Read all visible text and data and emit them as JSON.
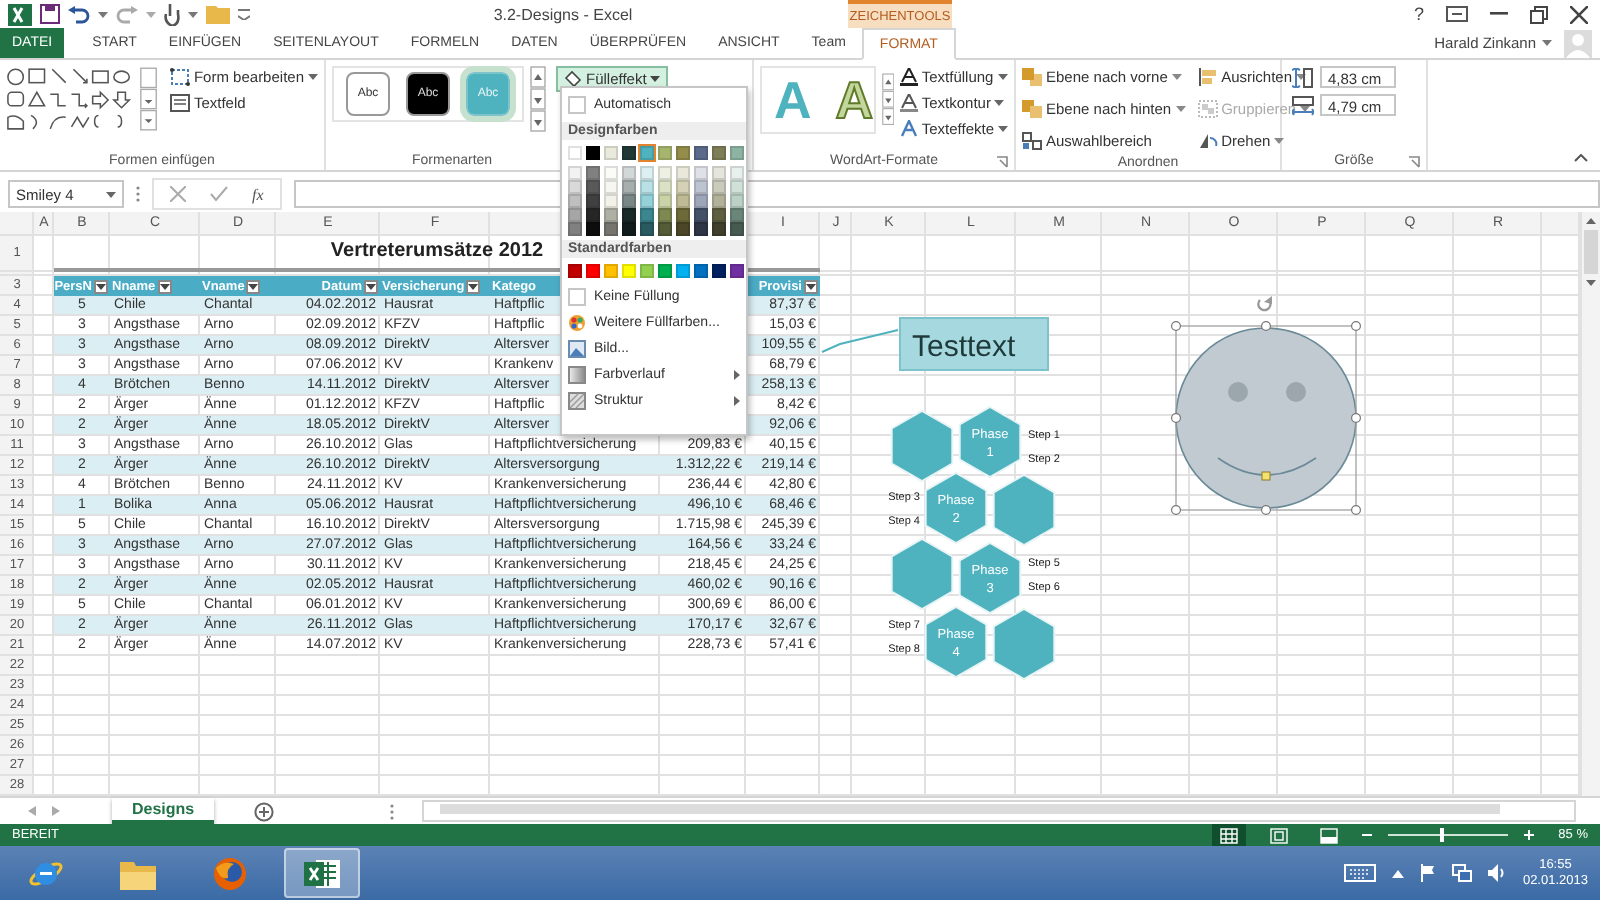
{
  "window": {
    "title": "3.2-Designs - Excel",
    "context_label": "ZEICHENTOOLS",
    "help": "?"
  },
  "tabs": [
    {
      "label": "DATEI",
      "kind": "file",
      "selected": false
    },
    {
      "label": "START",
      "kind": "tab",
      "selected": false
    },
    {
      "label": "EINFÜGEN",
      "kind": "tab",
      "selected": false
    },
    {
      "label": "SEITENLAYOUT",
      "kind": "tab",
      "selected": false
    },
    {
      "label": "FORMELN",
      "kind": "tab",
      "selected": false
    },
    {
      "label": "DATEN",
      "kind": "tab",
      "selected": false
    },
    {
      "label": "ÜBERPRÜFEN",
      "kind": "tab",
      "selected": false
    },
    {
      "label": "ANSICHT",
      "kind": "tab",
      "selected": false
    },
    {
      "label": "Team",
      "kind": "tab",
      "selected": false
    },
    {
      "label": "FORMAT",
      "kind": "context",
      "selected": true
    }
  ],
  "user": {
    "name": "Harald Zinkann"
  },
  "shapes_group": {
    "title": "Formen einfügen",
    "buttons": [
      {
        "label": "Form bearbeiten",
        "dropdown": true
      },
      {
        "label": "Textfeld",
        "dropdown": false
      }
    ]
  },
  "styles_group": {
    "title": "Formenarten",
    "styles": [
      {
        "label": "Abc",
        "kind": "outline",
        "selected": false
      },
      {
        "label": "Abc",
        "kind": "dark",
        "selected": false
      },
      {
        "label": "Abc",
        "kind": "teal",
        "selected": true
      }
    ],
    "fill_button": {
      "label": "Fülleffekt",
      "expanded": true
    }
  },
  "fill_menu": {
    "automatic": "Automatisch",
    "theme_header": "Designfarben",
    "standard_header": "Standardfarben",
    "theme_colors": [
      {
        "color": "#ffffff",
        "selected": false
      },
      {
        "color": "#000000",
        "selected": false
      },
      {
        "color": "#e9eadb",
        "selected": false
      },
      {
        "color": "#203735",
        "selected": false
      },
      {
        "color": "#4fb3bf",
        "selected": true
      },
      {
        "color": "#a6b56e",
        "selected": false
      },
      {
        "color": "#938c4b",
        "selected": false
      },
      {
        "color": "#5b6a8a",
        "selected": false
      },
      {
        "color": "#7d7e55",
        "selected": false
      },
      {
        "color": "#8db3a3",
        "selected": false
      }
    ],
    "standard_colors": [
      {
        "color": "#c00000"
      },
      {
        "color": "#ff0000"
      },
      {
        "color": "#ffc000"
      },
      {
        "color": "#ffff00"
      },
      {
        "color": "#92d050"
      },
      {
        "color": "#00b050"
      },
      {
        "color": "#00b0f0"
      },
      {
        "color": "#0070c0"
      },
      {
        "color": "#002060"
      },
      {
        "color": "#7030a0"
      }
    ],
    "items": [
      {
        "label": "Keine Füllung",
        "kind": "none",
        "submenu": false
      },
      {
        "label": "Weitere Füllfarben...",
        "kind": "palette",
        "submenu": false
      },
      {
        "label": "Bild...",
        "kind": "picture",
        "submenu": false
      },
      {
        "label": "Farbverlauf",
        "kind": "gradient",
        "submenu": true
      },
      {
        "label": "Struktur",
        "kind": "texture",
        "submenu": true
      }
    ]
  },
  "wordart_group": {
    "title": "WordArt-Formate",
    "samples": [
      {
        "label": "A",
        "kind": "filled"
      },
      {
        "label": "A",
        "kind": "outline"
      }
    ],
    "buttons": [
      {
        "label": "Textfüllung",
        "kind": "fill",
        "dropdown": true
      },
      {
        "label": "Textkontur",
        "kind": "outline",
        "dropdown": true
      },
      {
        "label": "Texteffekte",
        "kind": "effects",
        "dropdown": true
      }
    ]
  },
  "arrange_group": {
    "title": "Anordnen",
    "buttons": [
      {
        "label": "Ebene nach vorne",
        "kind": "front",
        "dropdown": true,
        "disabled": false
      },
      {
        "label": "Ebene nach hinten",
        "kind": "back",
        "dropdown": true,
        "disabled": false
      },
      {
        "label": "Auswahlbereich",
        "kind": "pane",
        "dropdown": false,
        "disabled": false
      },
      {
        "label": "Ausrichten",
        "kind": "align",
        "dropdown": true,
        "disabled": false
      },
      {
        "label": "Gruppieren",
        "kind": "group",
        "dropdown": true,
        "disabled": true
      },
      {
        "label": "Drehen",
        "kind": "rotate",
        "dropdown": true,
        "disabled": false
      }
    ]
  },
  "size_group": {
    "title": "Größe",
    "height": "4,83 cm",
    "width": "4,79 cm"
  },
  "formula_bar": {
    "name_box": "Smiley 4",
    "fx": "fx"
  },
  "sheet": {
    "columns": [
      "A",
      "B",
      "C",
      "D",
      "E",
      "F",
      "I",
      "J",
      "K",
      "L",
      "M",
      "N",
      "O",
      "P",
      "Q",
      "R"
    ],
    "row_numbers": [
      "1",
      "3",
      "4",
      "5",
      "6",
      "7",
      "8",
      "9",
      "10",
      "11",
      "12",
      "13",
      "14",
      "15",
      "16",
      "17",
      "18",
      "19",
      "20",
      "21",
      "22",
      "23",
      "24",
      "25",
      "26",
      "27",
      "28"
    ],
    "title": "Vertreterumsätze 2012",
    "headers": {
      "nr": {
        "label": "PersN",
        "filter": true
      },
      "nname": {
        "label": "Nname",
        "filter": true
      },
      "vname": {
        "label": "Vname",
        "filter": true
      },
      "datum": {
        "label": "Datum",
        "filter": true
      },
      "versicherung": {
        "label": "Versicherung",
        "filter": true
      },
      "kategorie": {
        "label": "Katego",
        "filter": false
      },
      "provision": {
        "label": "Provisi",
        "filter": true
      }
    },
    "rows": [
      {
        "nr": "5",
        "nname": "Chile",
        "vname": "Chantal",
        "datum": "04.02.2012",
        "versicherung": "Hausrat",
        "kategorie": "Haftpflic",
        "provision": "87,37 €"
      },
      {
        "nr": "3",
        "nname": "Angsthase",
        "vname": "Arno",
        "datum": "02.09.2012",
        "versicherung": "KFZV",
        "kategorie": "Haftpflic",
        "provision": "15,03 €"
      },
      {
        "nr": "3",
        "nname": "Angsthase",
        "vname": "Arno",
        "datum": "08.09.2012",
        "versicherung": "DirektV",
        "kategorie": "Altersver",
        "provision": "109,55 €"
      },
      {
        "nr": "3",
        "nname": "Angsthase",
        "vname": "Arno",
        "datum": "07.06.2012",
        "versicherung": "KV",
        "kategorie": "Krankenv",
        "provision": "68,79 €"
      },
      {
        "nr": "4",
        "nname": "Brötchen",
        "vname": "Benno",
        "datum": "14.11.2012",
        "versicherung": "DirektV",
        "kategorie": "Altersver",
        "provision": "258,13 €"
      },
      {
        "nr": "2",
        "nname": "Ärger",
        "vname": "Änne",
        "datum": "01.12.2012",
        "versicherung": "KFZV",
        "kategorie": "Haftpflic",
        "provision": "8,42 €"
      },
      {
        "nr": "2",
        "nname": "Ärger",
        "vname": "Änne",
        "datum": "18.05.2012",
        "versicherung": "DirektV",
        "kategorie": "Altersver",
        "provision": "92,06 €"
      },
      {
        "nr": "3",
        "nname": "Angsthase",
        "vname": "Arno",
        "datum": "26.10.2012",
        "versicherung": "Glas",
        "kategorie": "Haftpflichtversicherung",
        "betrag": "209,83 €",
        "provision": "40,15 €"
      },
      {
        "nr": "2",
        "nname": "Ärger",
        "vname": "Änne",
        "datum": "26.10.2012",
        "versicherung": "DirektV",
        "kategorie": "Altersversorgung",
        "betrag": "1.312,22 €",
        "provision": "219,14 €"
      },
      {
        "nr": "4",
        "nname": "Brötchen",
        "vname": "Benno",
        "datum": "24.11.2012",
        "versicherung": "KV",
        "kategorie": "Krankenversicherung",
        "betrag": "236,44 €",
        "provision": "42,80 €"
      },
      {
        "nr": "1",
        "nname": "Bolika",
        "vname": "Anna",
        "datum": "05.06.2012",
        "versicherung": "Hausrat",
        "kategorie": "Haftpflichtversicherung",
        "betrag": "496,10 €",
        "provision": "68,46 €"
      },
      {
        "nr": "5",
        "nname": "Chile",
        "vname": "Chantal",
        "datum": "16.10.2012",
        "versicherung": "DirektV",
        "kategorie": "Altersversorgung",
        "betrag": "1.715,98 €",
        "provision": "245,39 €"
      },
      {
        "nr": "3",
        "nname": "Angsthase",
        "vname": "Arno",
        "datum": "27.07.2012",
        "versicherung": "Glas",
        "kategorie": "Haftpflichtversicherung",
        "betrag": "164,56 €",
        "provision": "33,24 €"
      },
      {
        "nr": "3",
        "nname": "Angsthase",
        "vname": "Arno",
        "datum": "30.11.2012",
        "versicherung": "KV",
        "kategorie": "Krankenversicherung",
        "betrag": "218,45 €",
        "provision": "24,25 €"
      },
      {
        "nr": "2",
        "nname": "Ärger",
        "vname": "Änne",
        "datum": "02.05.2012",
        "versicherung": "Hausrat",
        "kategorie": "Haftpflichtversicherung",
        "betrag": "460,02 €",
        "provision": "90,16 €"
      },
      {
        "nr": "5",
        "nname": "Chile",
        "vname": "Chantal",
        "datum": "06.01.2012",
        "versicherung": "KV",
        "kategorie": "Krankenversicherung",
        "betrag": "300,69 €",
        "provision": "86,00 €"
      },
      {
        "nr": "2",
        "nname": "Ärger",
        "vname": "Änne",
        "datum": "26.11.2012",
        "versicherung": "Glas",
        "kategorie": "Haftpflichtversicherung",
        "betrag": "170,17 €",
        "provision": "32,67 €"
      },
      {
        "nr": "2",
        "nname": "Ärger",
        "vname": "Änne",
        "datum": "14.07.2012",
        "versicherung": "KV",
        "kategorie": "Krankenversicherung",
        "betrag": "228,73 €",
        "provision": "57,41 €"
      }
    ]
  },
  "shapes": {
    "callout": {
      "text": "Testtext"
    },
    "smiley": {
      "selected": true
    },
    "hexagons": [
      {
        "kind": "plain"
      },
      {
        "kind": "phase",
        "lines": [
          "Phase",
          "1"
        ]
      },
      {
        "kind": "phase",
        "lines": [
          "Phase",
          "2"
        ]
      },
      {
        "kind": "plain"
      },
      {
        "kind": "plain"
      },
      {
        "kind": "phase",
        "lines": [
          "Phase",
          "3"
        ]
      },
      {
        "kind": "phase",
        "lines": [
          "Phase",
          "4"
        ]
      },
      {
        "kind": "plain"
      }
    ],
    "steps": [
      "Step 1",
      "Step 2",
      "Step 3",
      "Step 4",
      "Step 5",
      "Step 6",
      "Step 7",
      "Step 8"
    ]
  },
  "sheet_tabs": [
    {
      "label": "Designs",
      "selected": true
    }
  ],
  "status_bar": {
    "status": "BEREIT",
    "views": [
      {
        "kind": "normal",
        "selected": true
      },
      {
        "kind": "layout",
        "selected": false
      },
      {
        "kind": "pagebreak",
        "selected": false
      }
    ],
    "zoom": {
      "level": 0.45,
      "reading": "85 %"
    }
  },
  "taskbar": {
    "apps": [
      {
        "kind": "ie",
        "selected": false
      },
      {
        "kind": "explorer",
        "selected": false
      },
      {
        "kind": "firefox",
        "selected": false
      },
      {
        "kind": "excel",
        "selected": true
      }
    ],
    "time": "16:55",
    "date": "02.01.2013"
  }
}
